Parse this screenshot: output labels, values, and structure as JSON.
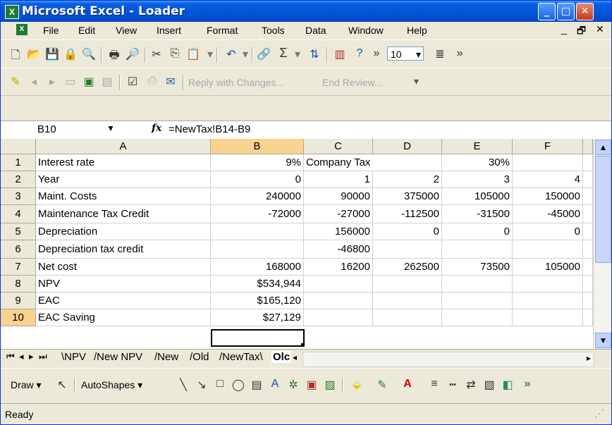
{
  "window": {
    "title": "Microsoft Excel - Loader",
    "controls": {
      "minimize": "_",
      "maximize": "□",
      "close": "✕"
    }
  },
  "menu": [
    "File",
    "Edit",
    "View",
    "Insert",
    "Format",
    "Tools",
    "Data",
    "Window",
    "Help"
  ],
  "mdi_controls": {
    "minimize": "_",
    "restore": "🗗",
    "close": "✕"
  },
  "toolbar": {
    "font_size": "10",
    "review_bar": {
      "reply_label": "Reply with Changes...",
      "end_review_label": "End Review..."
    }
  },
  "formula_bar": {
    "name_box": "B10",
    "fx": "fx",
    "formula": "=NewTax!B14-B9"
  },
  "grid": {
    "columns": [
      "A",
      "B",
      "C",
      "D",
      "E",
      "F"
    ],
    "rows": [
      {
        "n": "1",
        "a": "Interest rate",
        "b": "9%",
        "c": "Company Tax",
        "d": "",
        "e": "30%",
        "f": ""
      },
      {
        "n": "2",
        "a": "Year",
        "b": "0",
        "c": "1",
        "d": "2",
        "e": "3",
        "f": "4"
      },
      {
        "n": "3",
        "a": "Maint. Costs",
        "b": "240000",
        "c": "90000",
        "d": "375000",
        "e": "105000",
        "f": "150000"
      },
      {
        "n": "4",
        "a": "Maintenance Tax Credit",
        "b": "-72000",
        "c": "-27000",
        "d": "-112500",
        "e": "-31500",
        "f": "-45000"
      },
      {
        "n": "5",
        "a": "Depreciation",
        "b": "",
        "c": "156000",
        "d": "0",
        "e": "0",
        "f": "0"
      },
      {
        "n": "6",
        "a": "Depreciation tax credit",
        "b": "",
        "c": "-46800",
        "d": "",
        "e": "",
        "f": ""
      },
      {
        "n": "7",
        "a": "Net cost",
        "b": "168000",
        "c": "16200",
        "d": "262500",
        "e": "73500",
        "f": "105000"
      },
      {
        "n": "8",
        "a": "NPV",
        "b": "$534,944",
        "c": "",
        "d": "",
        "e": "",
        "f": ""
      },
      {
        "n": "9",
        "a": "EAC",
        "b": "$165,120",
        "c": "",
        "d": "",
        "e": "",
        "f": ""
      },
      {
        "n": "10",
        "a": "EAC Saving",
        "b": "$27,129",
        "c": "",
        "d": "",
        "e": "",
        "f": ""
      }
    ]
  },
  "sheet_tabs": [
    "NPV",
    "New NPV",
    "New",
    "Old",
    "NewTax",
    "Olc"
  ],
  "draw_toolbar": {
    "draw_label": "Draw ▾",
    "autoshapes_label": "AutoShapes ▾"
  },
  "status": "Ready"
}
